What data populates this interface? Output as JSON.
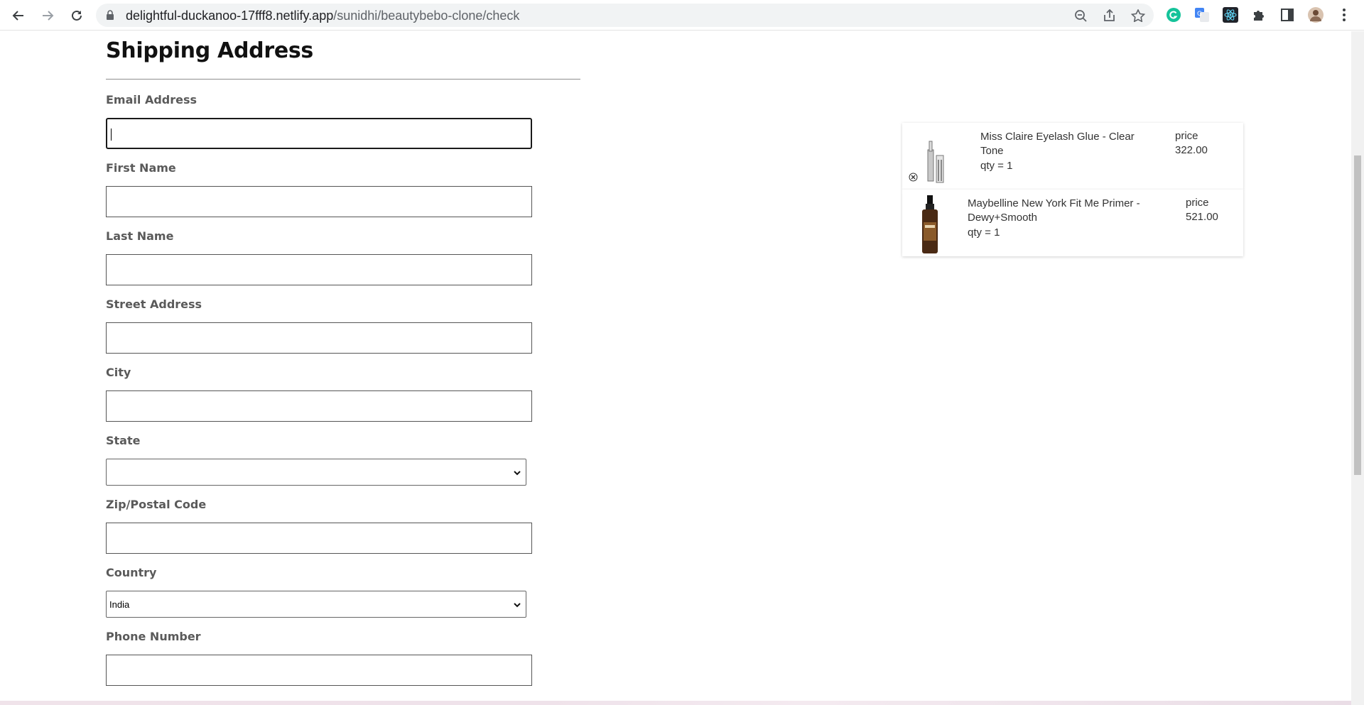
{
  "browser": {
    "url_host": "delightful-duckanoo-17fff8.netlify.app",
    "url_path": "/sunidhi/beautybebo-clone/check"
  },
  "form": {
    "title": "Shipping Address",
    "email_label": "Email Address",
    "first_name_label": "First Name",
    "last_name_label": "Last Name",
    "street_label": "Street Address",
    "city_label": "City",
    "state_label": "State",
    "state_value": "",
    "zip_label": "Zip/Postal Code",
    "country_label": "Country",
    "country_value": "India",
    "phone_label": "Phone Number"
  },
  "cart": {
    "items": [
      {
        "name_line1": "Miss Claire Eyelash Glue - Clear",
        "name_line2": "Tone",
        "qty": "qty = 1",
        "price_label": "price",
        "price": "322.00"
      },
      {
        "name_line1": "Maybelline New York Fit Me Primer -",
        "name_line2": "Dewy+Smooth",
        "qty": "qty = 1",
        "price_label": "price",
        "price": "521.00"
      }
    ]
  }
}
